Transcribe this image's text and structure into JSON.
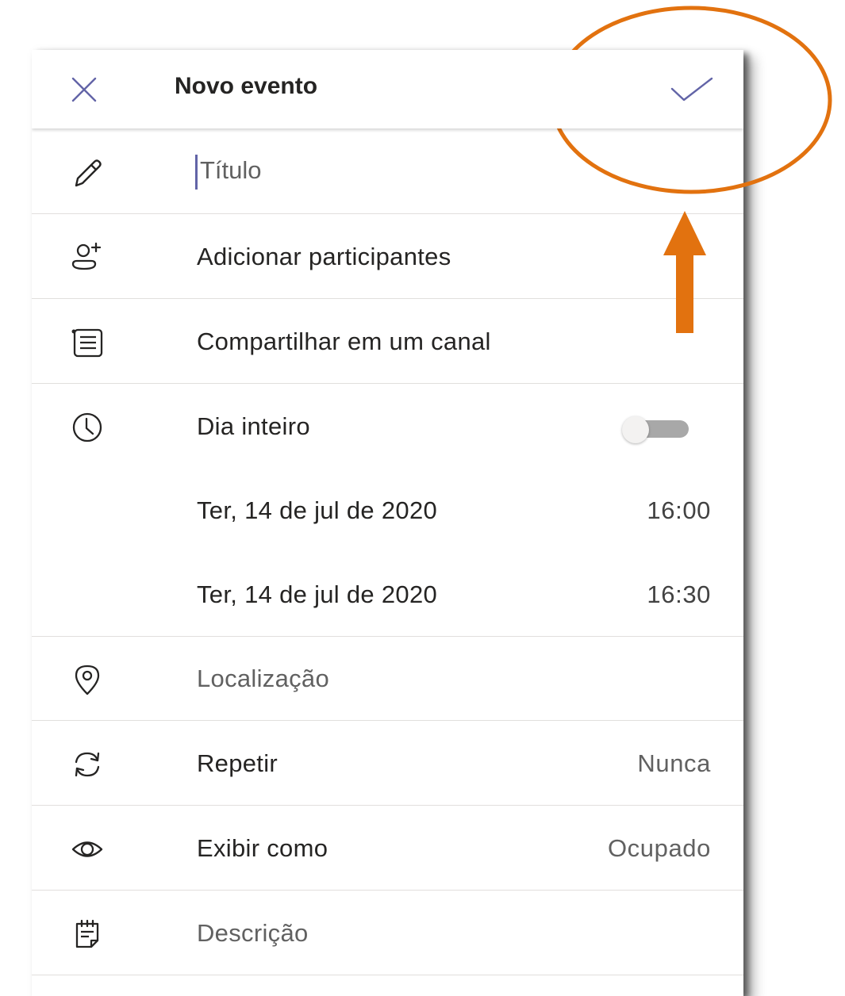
{
  "header": {
    "title": "Novo evento",
    "close_icon": "close-icon",
    "confirm_icon": "checkmark-icon"
  },
  "form": {
    "title_placeholder": "Título",
    "title_value": "",
    "participants_label": "Adicionar participantes",
    "channel_label": "Compartilhar em um canal",
    "allday_label": "Dia inteiro",
    "allday_enabled": false,
    "start_date": "Ter, 14 de jul de 2020",
    "start_time": "16:00",
    "end_date": "Ter, 14 de jul de 2020",
    "end_time": "16:30",
    "location_label": "Localização",
    "repeat_label": "Repetir",
    "repeat_value": "Nunca",
    "show_as_label": "Exibir como",
    "show_as_value": "Ocupado",
    "description_label": "Descrição"
  },
  "icons": {
    "title": "pencil-icon",
    "participants": "add-person-icon",
    "channel": "channel-list-icon",
    "allday": "clock-icon",
    "location": "location-pin-icon",
    "repeat": "repeat-icon",
    "show_as": "eye-icon",
    "description": "notepad-icon"
  },
  "colors": {
    "accent": "#6264a7",
    "annotation": "#e2720f"
  }
}
